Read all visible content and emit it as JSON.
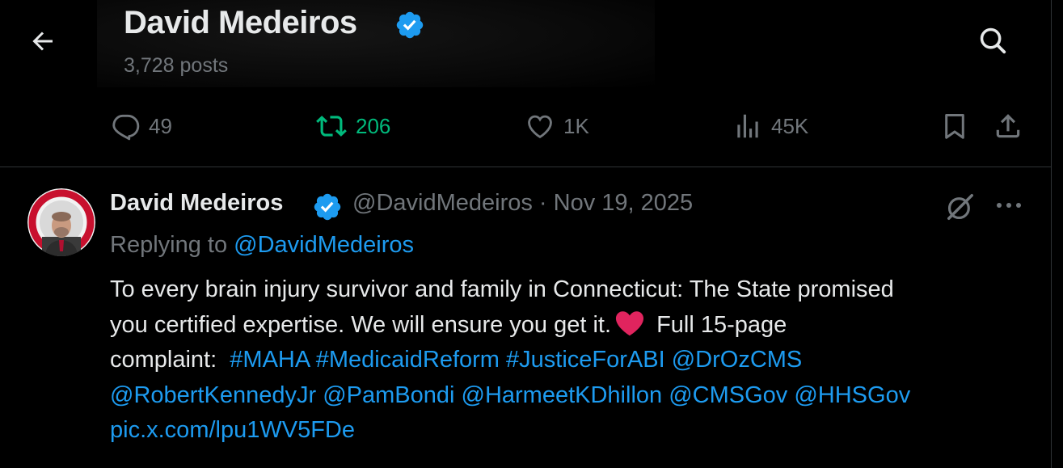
{
  "header": {
    "title": "David Medeiros",
    "posts_count": "3,728 posts",
    "back_icon": "arrow-left-icon",
    "search_icon": "search-icon"
  },
  "actions": {
    "replies": "49",
    "reposts": "206",
    "likes": "1K",
    "views": "45K"
  },
  "tweet": {
    "author_name": "David Medeiros",
    "meta": "@DavidMedeiros · Nov 19, 2025",
    "replying_prefix": "Replying to",
    "replying_to": "@DavidMedeiros",
    "text_line1": "To every brain injury survivor and family in Connecticut: The State promised",
    "text_line2a": "you certified expertise. We will ensure you get it.",
    "text_line2b": "Full 15-page",
    "text_line3a": "complaint:",
    "hashtag1": "#MAHA",
    "hashtag2": "#MedicaidReform",
    "hashtag3": "#JusticeForABI",
    "mention1": "@DrOzCMS",
    "mention2": "@RobertKennedyJr",
    "mention3": "@PamBondi",
    "mention4": "@HarmeetKDhillon",
    "mention5": "@CMSGov",
    "mention6": "@HHSGov",
    "media_link": "pic.x.com/lpu1WV5FDe"
  },
  "colors": {
    "background": "#000000",
    "text": "#e7e9ea",
    "muted": "#71767b",
    "link": "#1d9bf0",
    "repost_active": "#00ba7c",
    "heart_emoji": "#e0245e",
    "verified": "#1d9bf0"
  }
}
